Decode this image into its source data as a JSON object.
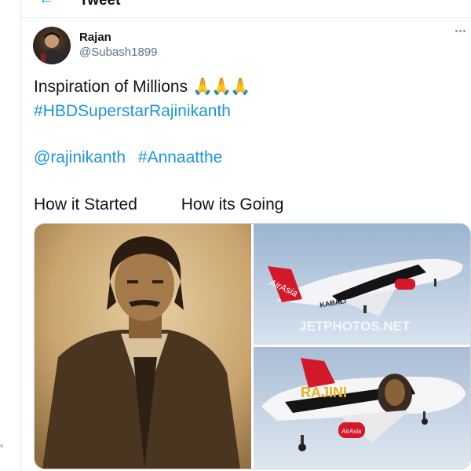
{
  "header": {
    "title": "Tweet"
  },
  "user": {
    "name": "Rajan",
    "handle": "@Subash1899"
  },
  "tweet": {
    "line1_text": "Inspiration of Millions",
    "line1_emoji": "🙏🙏🙏",
    "hashtag1": "#HBDSuperstarRajinikanth",
    "mention": "@rajinikanth",
    "hashtag2": "#Annaatthe",
    "caption_a": "How it Started",
    "caption_b": "How its Going"
  },
  "media": {
    "left_photo": "sepia portrait",
    "airline_livery": "AirAsia",
    "livery_text": "KABALI",
    "fuselage_text": "RAJINI",
    "watermark": "JETPHOTOS.NET"
  },
  "colors": {
    "accent": "#1b95e0",
    "border": "#e6ecf0",
    "muted": "#5b7083"
  },
  "icons": [
    "back-arrow-icon",
    "more-options-icon"
  ]
}
